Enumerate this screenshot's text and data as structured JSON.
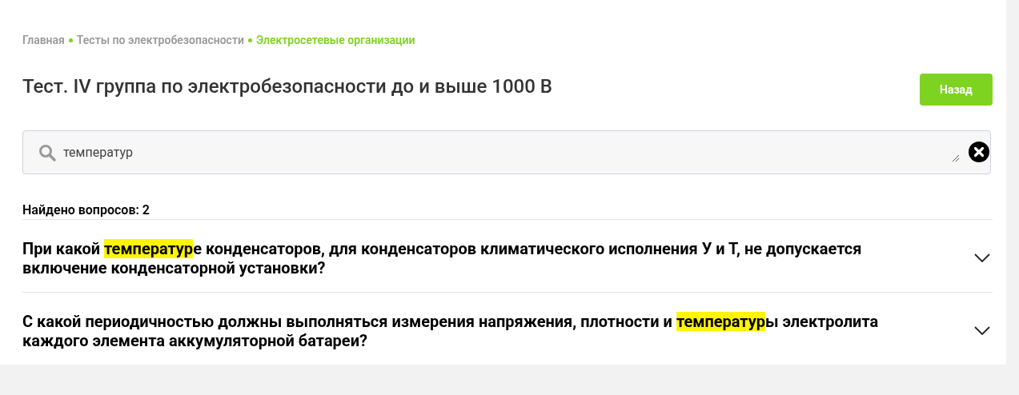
{
  "breadcrumbs": [
    {
      "label": "Главная",
      "selected": false
    },
    {
      "label": "Тесты по электробезопасности",
      "selected": false
    },
    {
      "label": "Электросетевые организации",
      "selected": true
    }
  ],
  "title": "Тест. IV группа по электробезопасности до и выше 1000 В",
  "back_button": "Назад",
  "search": {
    "value": "температур"
  },
  "found_count": "Найдено вопросов: 2",
  "questions": [
    {
      "expanded": false,
      "segments": [
        {
          "text": "При какой ",
          "highlighted": false
        },
        {
          "text": "температур",
          "highlighted": true
        },
        {
          "text": "е конденсаторов, для конденсаторов климатического исполнения У и Т, не допускается включение конденсаторной установки?",
          "highlighted": false
        }
      ]
    },
    {
      "expanded": false,
      "segments": [
        {
          "text": "С какой периодичностью должны выполняться измерения напряжения, плотности и ",
          "highlighted": false
        },
        {
          "text": "температур",
          "highlighted": true
        },
        {
          "text": "ы электролита каждого элемента аккумуляторной батареи?",
          "highlighted": false
        }
      ]
    }
  ]
}
